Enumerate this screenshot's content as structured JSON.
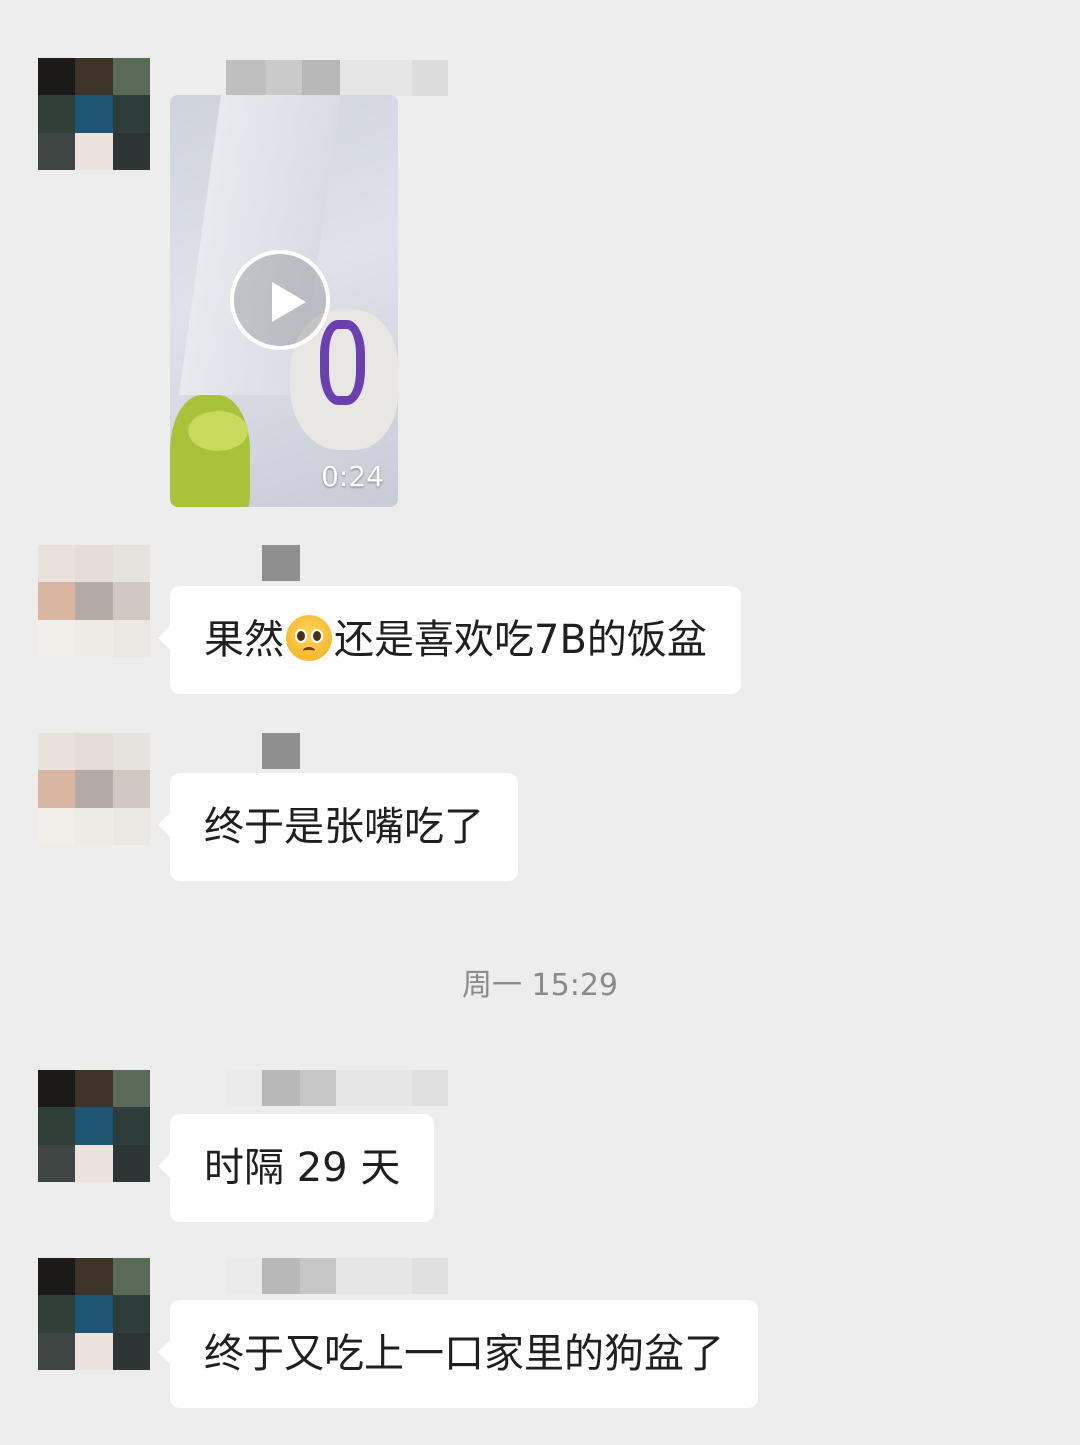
{
  "messages": [
    {
      "type": "video",
      "duration": "0:24"
    },
    {
      "type": "text",
      "text_before_emoji": "果然",
      "emoji": "pleading-face",
      "text_after_emoji": "还是喜欢吃7B的饭盆"
    },
    {
      "type": "text",
      "text": "终于是张嘴吃了"
    },
    {
      "type": "text",
      "text": "时隔 29 天"
    },
    {
      "type": "text",
      "text": "终于又吃上一口家里的狗盆了"
    }
  ],
  "timestamp": "周一 15:29",
  "colors": {
    "background": "#ededed",
    "bubble": "#ffffff",
    "text": "#1f1f1f",
    "timestamp": "#8a8a8a"
  },
  "avatars": {
    "dark": [
      "#1b1a18",
      "#3e342a",
      "#596a58",
      "#2f3e37",
      "#1e5572",
      "#2d3d39",
      "#3f4643",
      "#ebe3dc",
      "#2c3533"
    ],
    "light": [
      "#e9e2da",
      "#e3ddd6",
      "#e6e2dd",
      "#d9b6a2",
      "#b5aba5",
      "#cfc8c1",
      "#f2efea",
      "#efebe6",
      "#ebe8e3"
    ]
  }
}
